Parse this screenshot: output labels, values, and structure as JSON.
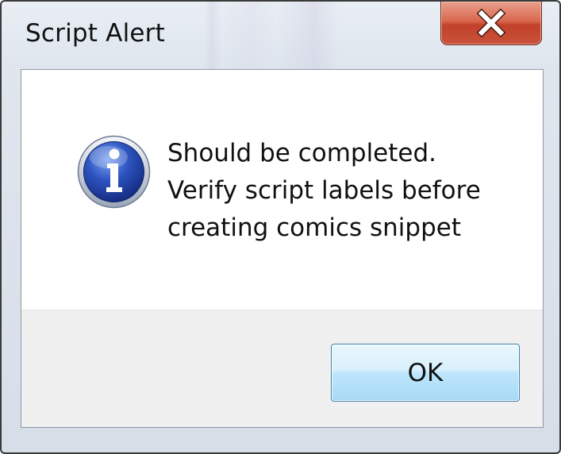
{
  "dialog": {
    "title": "Script Alert",
    "close_icon": "close-x-icon",
    "message_icon": "info-icon",
    "message_lines": [
      "Should be completed.",
      "Verify script labels before",
      "creating comics snippet"
    ],
    "ok_label": "OK"
  },
  "colors": {
    "close_button": "#c9523a",
    "info_icon": "#2a4fb8",
    "ok_button_border": "#3c7fb1"
  }
}
